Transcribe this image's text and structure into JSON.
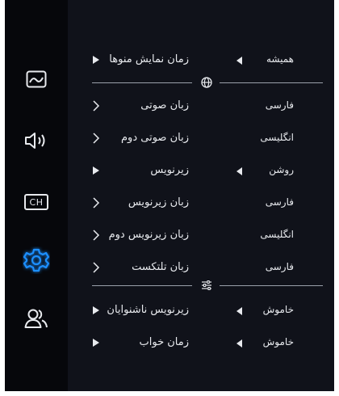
{
  "sidebar": {
    "items": [
      {
        "name": "picture",
        "icon": "picture-icon"
      },
      {
        "name": "sound",
        "icon": "speaker-icon"
      },
      {
        "name": "channel",
        "icon": "ch-icon",
        "label": "CH"
      },
      {
        "name": "settings",
        "icon": "gear-icon",
        "active": true
      },
      {
        "name": "users",
        "icon": "users-icon"
      }
    ],
    "active_color": "#1e8fff"
  },
  "settings": {
    "rows": [
      {
        "label": "زمان نمایش منوها",
        "value": "همیشه",
        "type": "cycle"
      },
      {
        "label": "زبان صوتی",
        "value": "فارسی",
        "type": "submenu"
      },
      {
        "label": "زبان صوتی دوم",
        "value": "انگلیسی",
        "type": "submenu"
      },
      {
        "label": "زیرنویس",
        "value": "روشن",
        "type": "cycle"
      },
      {
        "label": "زبان زیرنویس",
        "value": "فارسی",
        "type": "submenu"
      },
      {
        "label": "زبان زیرنویس دوم",
        "value": "انگلیسی",
        "type": "submenu"
      },
      {
        "label": "زبان تلتکست",
        "value": "فارسی",
        "type": "submenu"
      },
      {
        "label": "زیرنویس ناشنوایان",
        "value": "خاموش",
        "type": "cycle"
      },
      {
        "label": "زمان خواب",
        "value": "خاموش",
        "type": "cycle"
      }
    ],
    "dividers": [
      {
        "icon": "globe-icon"
      },
      {
        "icon": "sliders-icon"
      }
    ]
  }
}
